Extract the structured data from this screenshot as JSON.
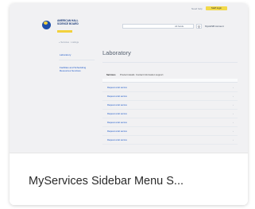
{
  "card": {
    "caption": "MyServices Sidebar Menu S..."
  },
  "thumbnail": {
    "topbar": {
      "link": "Need help",
      "button": "Staff login"
    },
    "header": {
      "logo_text": "AMERICAN HALL SCIENCE BOARD",
      "search_select": "All fields",
      "search_button_icon": "search-icon",
      "account": "MyAHSB Account"
    },
    "breadcrumb": "« Services · Listings",
    "sidebar": {
      "items": [
        {
          "label": "Laboratory"
        },
        {
          "label": "Facilities and Scheduling Resources Services"
        }
      ]
    },
    "main": {
      "title": "Laboratory",
      "tabs": [
        {
          "label": "Services"
        },
        {
          "label": "Product details"
        },
        {
          "label": "Contact information support"
        }
      ],
      "rows": [
        {
          "label": "Request a lab service"
        },
        {
          "label": "Request a lab service"
        },
        {
          "label": "Request a lab service"
        },
        {
          "label": "Request a lab service"
        },
        {
          "label": "Request a lab service"
        },
        {
          "label": "Request a lab service"
        },
        {
          "label": "Request a lab service"
        }
      ]
    },
    "colors": {
      "brand_blue": "#1f4fa8",
      "brand_yellow": "#f2d13d",
      "link_blue": "#1a56c7"
    }
  }
}
